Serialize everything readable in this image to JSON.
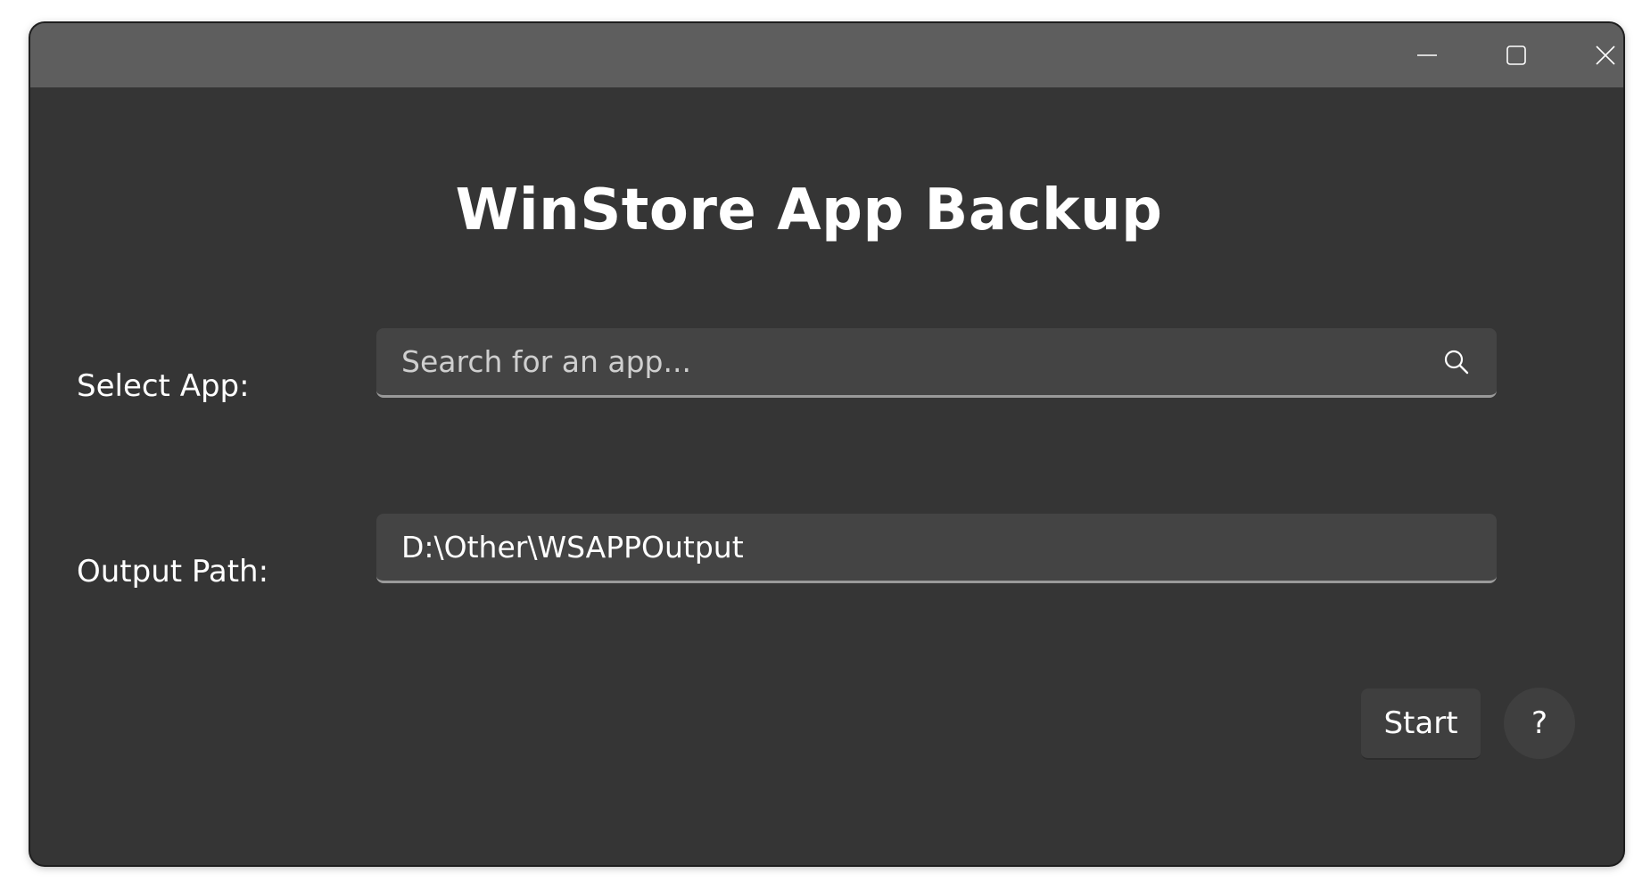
{
  "window": {
    "caption_buttons": {
      "minimize_icon": "minimize-icon",
      "maximize_icon": "maximize-icon",
      "close_icon": "close-icon"
    }
  },
  "header": {
    "title": "WinStore App Backup"
  },
  "form": {
    "select_app": {
      "label": "Select App:",
      "placeholder": "Search for an app...",
      "value": "",
      "icon": "search-icon"
    },
    "output_path": {
      "label": "Output Path:",
      "value": "D:\\Other\\WSAPPOutput"
    }
  },
  "actions": {
    "start_label": "Start",
    "help_label": "?"
  },
  "colors": {
    "window_bg": "#353535",
    "titlebar_bg": "#5e5e5e",
    "textbox_bg": "#444444",
    "text": "#ffffff"
  }
}
